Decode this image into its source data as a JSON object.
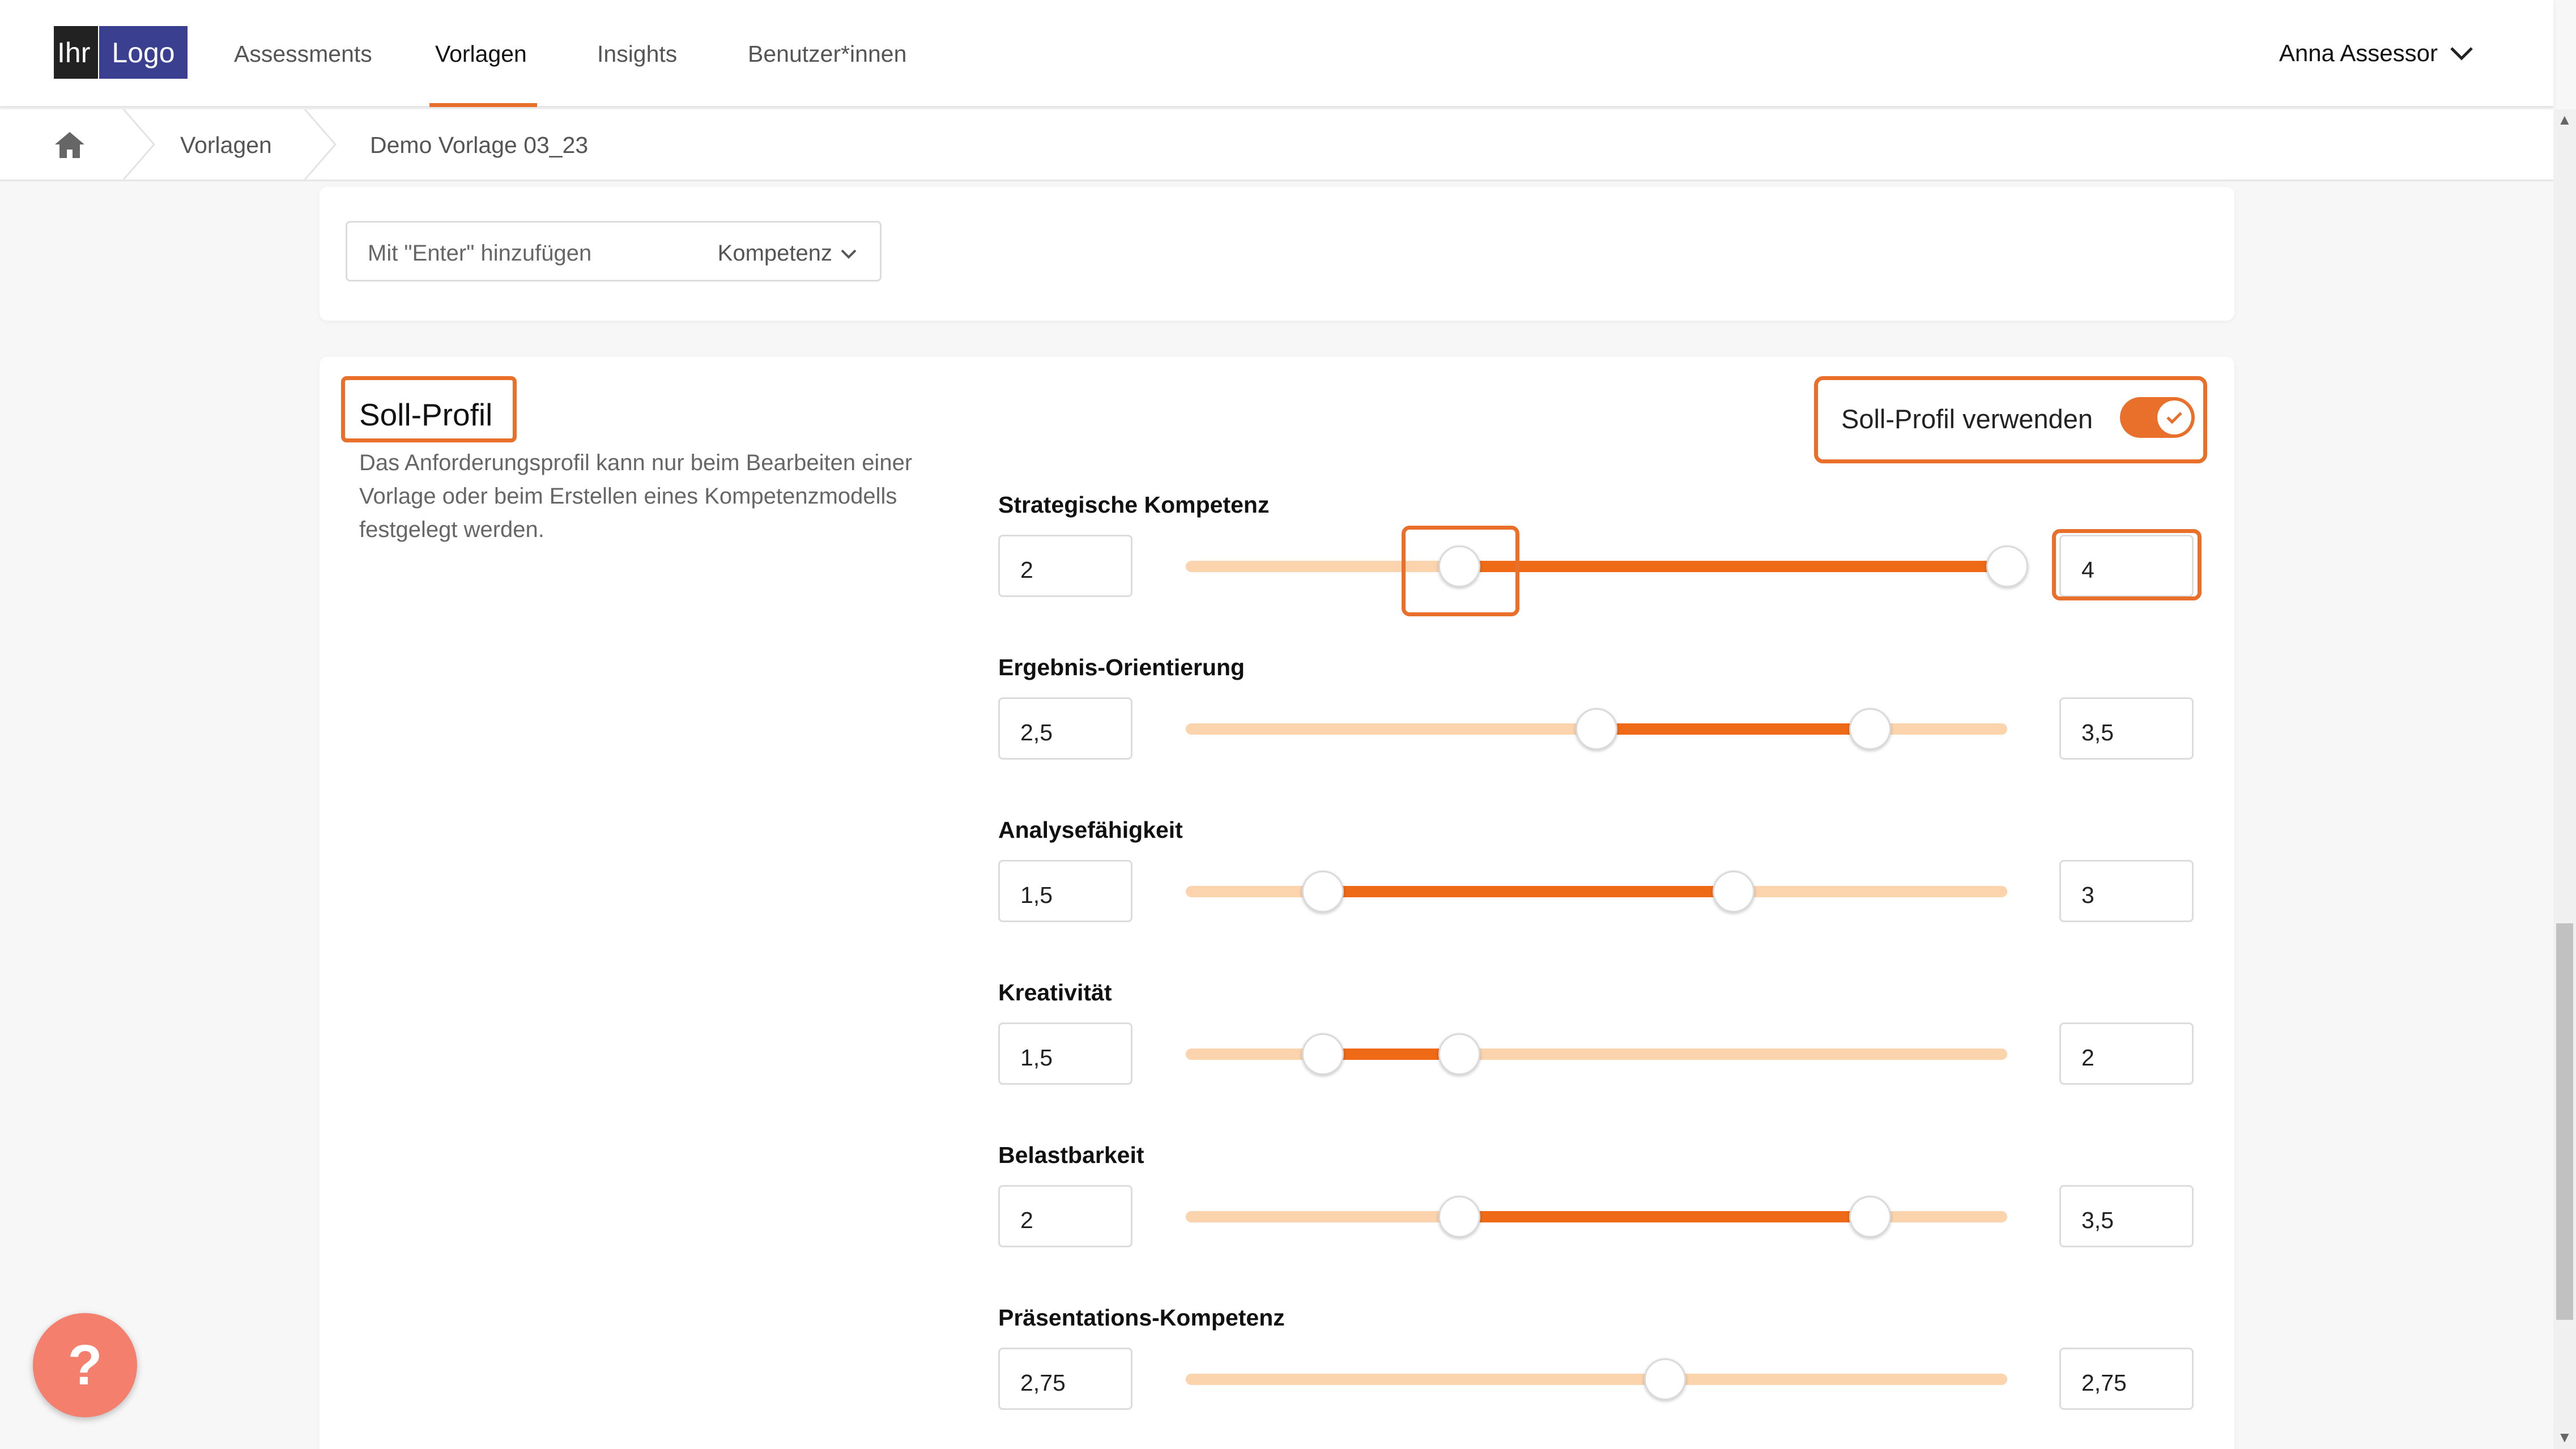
{
  "colors": {
    "accent": "#e8702a",
    "track": "#fbd3ad",
    "fill": "#ef6a17",
    "help": "#f47f6d"
  },
  "logo": {
    "left": "Ihr",
    "right": "Logo"
  },
  "nav": {
    "items": [
      {
        "label": "Assessments"
      },
      {
        "label": "Vorlagen",
        "active": true
      },
      {
        "label": "Insights"
      },
      {
        "label": "Benutzer*innen"
      }
    ],
    "user": "Anna Assessor"
  },
  "breadcrumb": {
    "items": [
      "Vorlagen",
      "Demo Vorlage 03_23"
    ]
  },
  "add_field": {
    "placeholder": "Mit \"Enter\" hinzufügen",
    "type_label": "Kompetenz"
  },
  "soll_profil": {
    "title": "Soll-Profil",
    "description": "Das Anforderungsprofil kann nur beim Bearbeiten einer Vorlage oder beim Erstellen eines Kompetenzmodells festgelegt werden.",
    "toggle_label": "Soll-Profil verwenden",
    "toggle_on": true,
    "scale": {
      "min": 1,
      "max": 4
    },
    "rows": [
      {
        "name": "Strategische Kompetenz",
        "min": "2",
        "max": "4",
        "min_val": 2,
        "max_val": 4
      },
      {
        "name": "Ergebnis-Orientierung",
        "min": "2,5",
        "max": "3,5",
        "min_val": 2.5,
        "max_val": 3.5
      },
      {
        "name": "Analysefähigkeit",
        "min": "1,5",
        "max": "3",
        "min_val": 1.5,
        "max_val": 3
      },
      {
        "name": "Kreativität",
        "min": "1,5",
        "max": "2",
        "min_val": 1.5,
        "max_val": 2
      },
      {
        "name": "Belastbarkeit",
        "min": "2",
        "max": "3,5",
        "min_val": 2,
        "max_val": 3.5
      },
      {
        "name": "Präsentations-Kompetenz",
        "min": "2,75",
        "max": "2,75",
        "min_val": 2.75,
        "max_val": 2.75
      }
    ]
  },
  "help": {
    "label": "?"
  }
}
